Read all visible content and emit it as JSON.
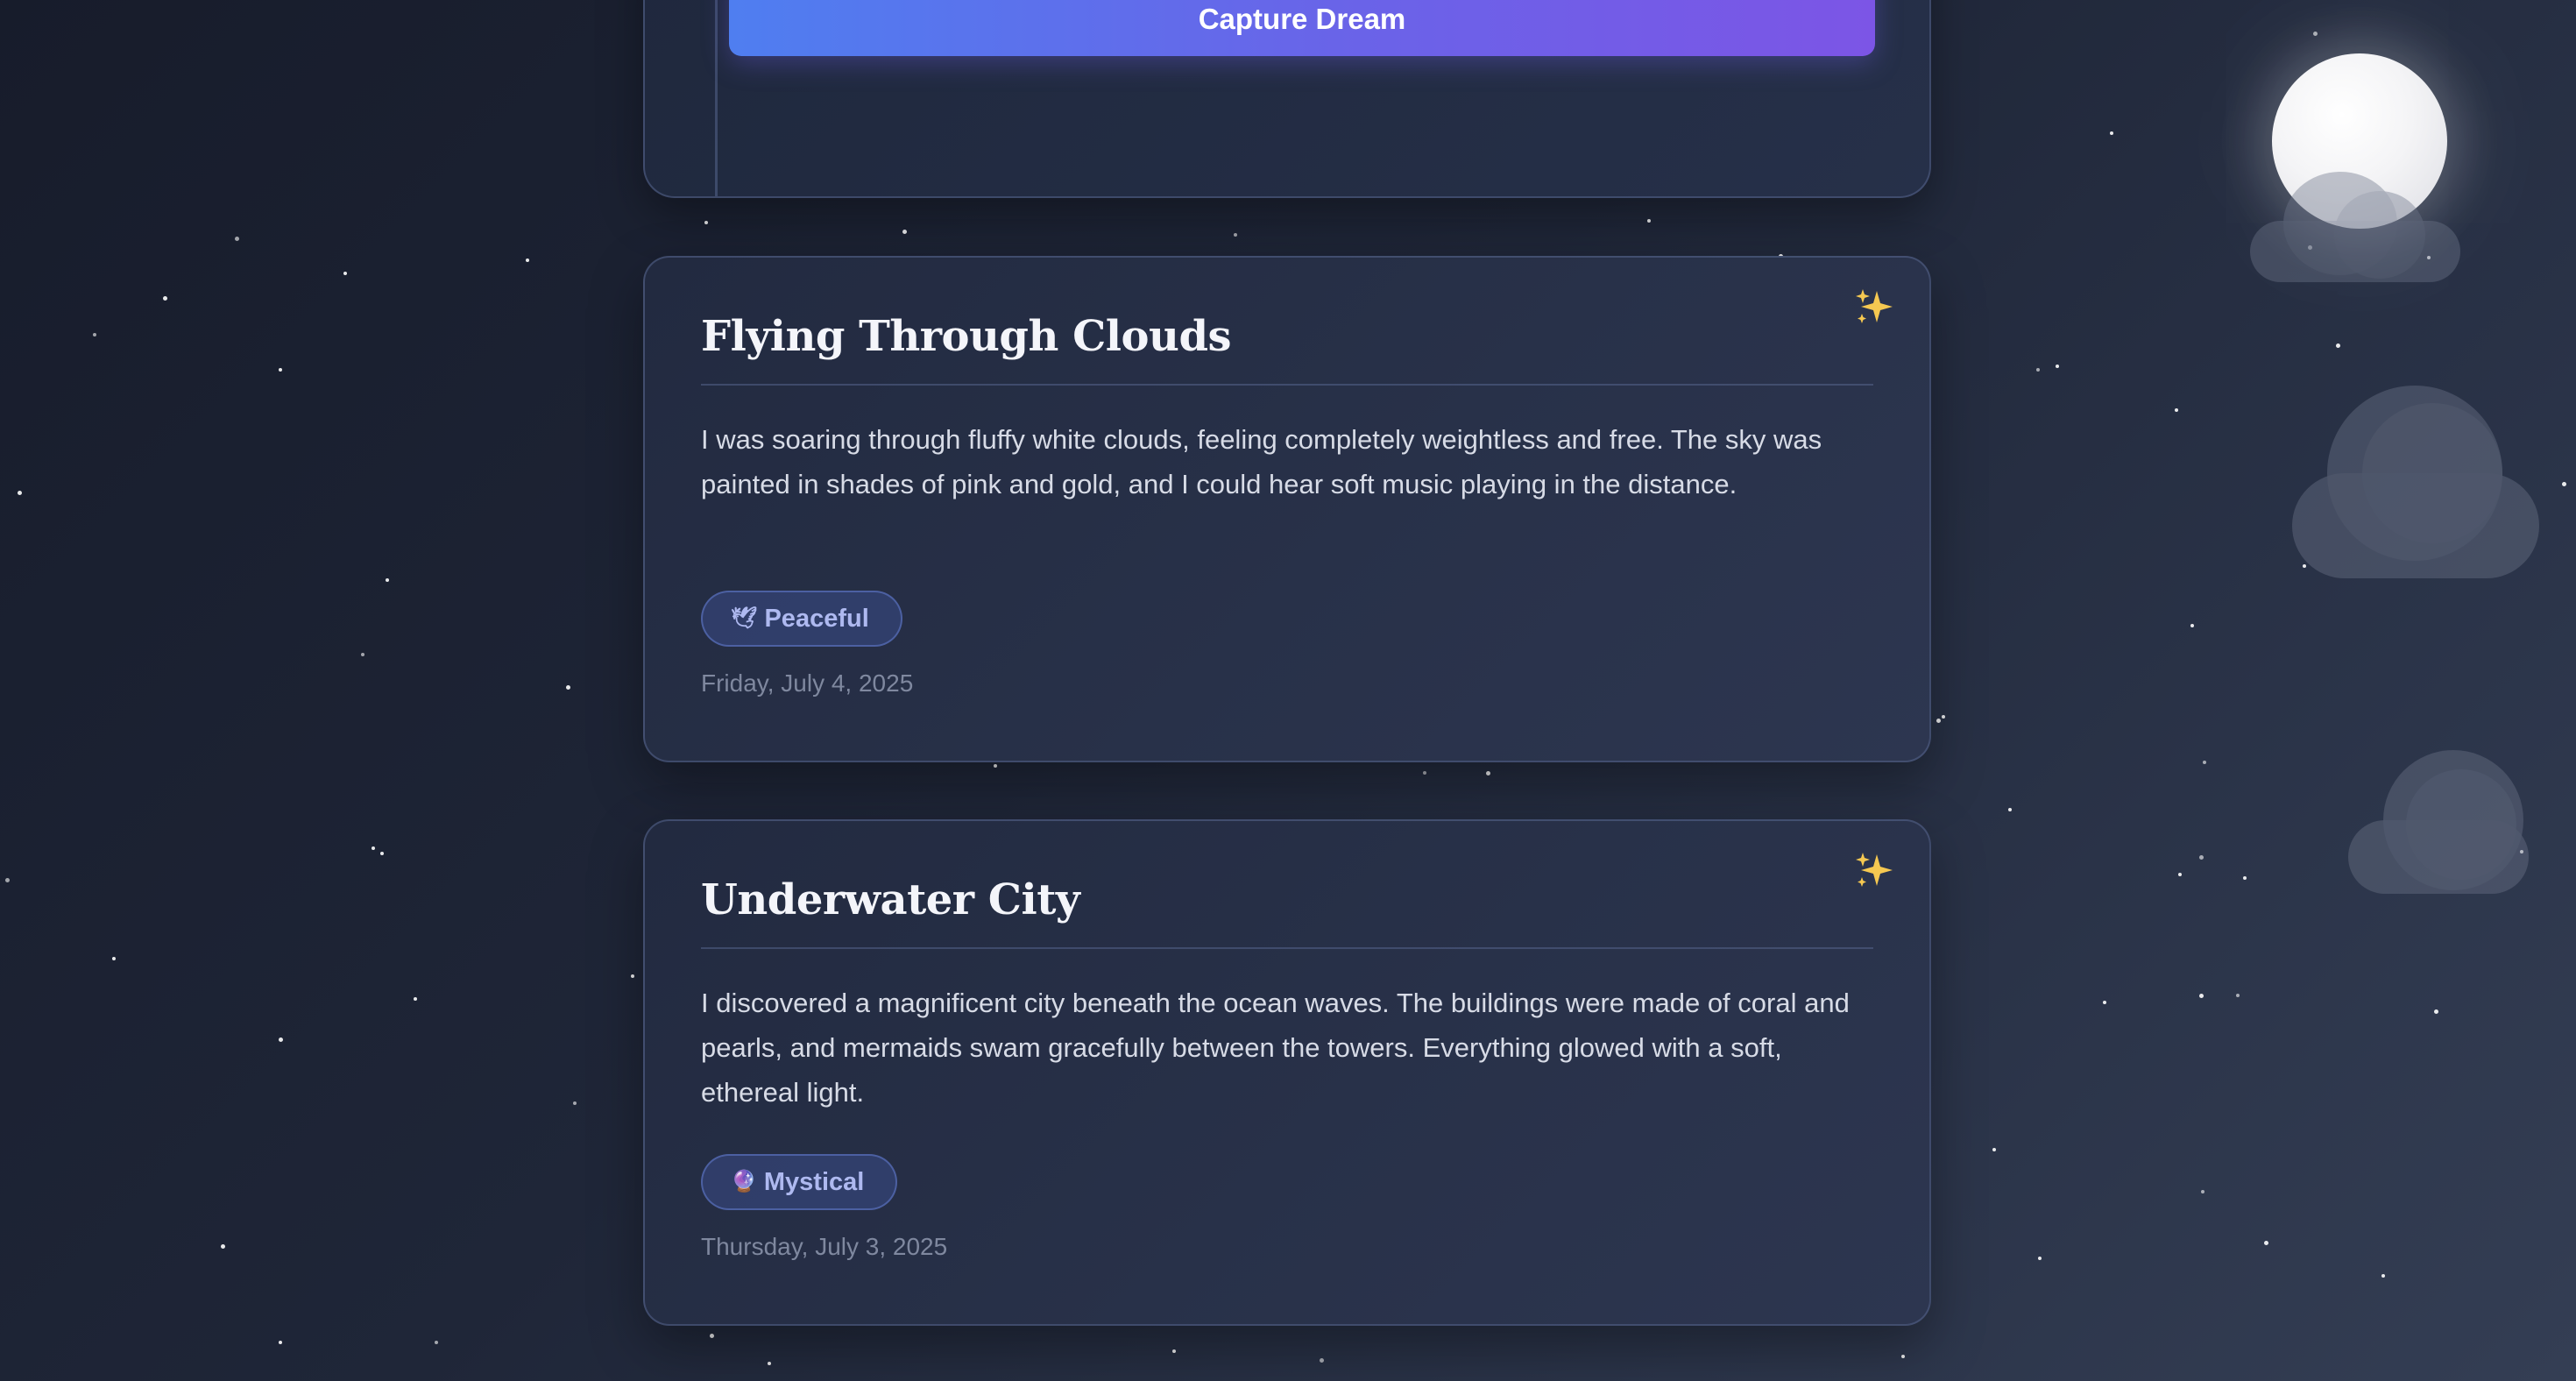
{
  "form": {
    "submit_label": "Capture Dream"
  },
  "dreams": [
    {
      "title": "Flying Through Clouds",
      "description": "I was soaring through fluffy white clouds, feeling completely weightless and free. The sky was painted in shades of pink and gold, and I could hear soft music playing in the distance.",
      "mood_icon": "🕊",
      "mood": "Peaceful",
      "date": "Friday, July 4, 2025"
    },
    {
      "title": "Underwater City",
      "description": "I discovered a magnificent city beneath the ocean waves. The buildings were made of coral and pearls, and mermaids swam gracefully between the towers. Everything glowed with a soft, ethereal light.",
      "mood_icon": "🔮",
      "mood": "Mystical",
      "date": "Thursday, July 3, 2025"
    }
  ],
  "decor": {
    "sparkle_icon": "sparkles-icon",
    "moon": "moon",
    "accent_gradient": [
      "#4f7ef0",
      "#7c55e6"
    ],
    "sparkle_color": "#f5c851"
  }
}
